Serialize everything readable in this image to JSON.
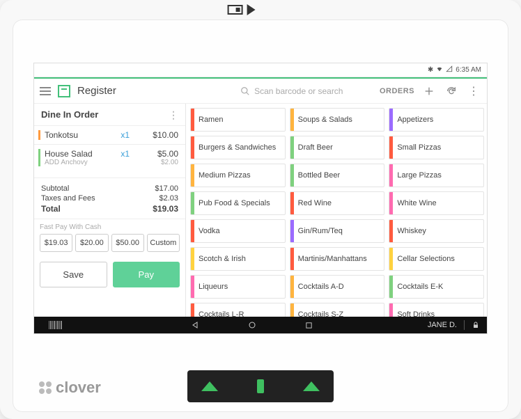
{
  "statusbar": {
    "time": "6:35 AM"
  },
  "appbar": {
    "title": "Register",
    "search_placeholder": "Scan barcode or search",
    "orders_label": "ORDERS"
  },
  "order": {
    "header": "Dine In Order",
    "items": [
      {
        "name": "Tonkotsu",
        "qty": "x1",
        "price": "$10.00",
        "mods": []
      },
      {
        "name": "House Salad",
        "qty": "x1",
        "price": "$5.00",
        "mods": [
          {
            "name": "ADD Anchovy",
            "price": "$2.00"
          }
        ]
      }
    ],
    "subtotal_label": "Subtotal",
    "subtotal": "$17.00",
    "taxes_label": "Taxes and Fees",
    "taxes": "$2.03",
    "total_label": "Total",
    "total": "$19.03",
    "fastpay_label": "Fast Pay With Cash",
    "fastpay": [
      "$19.03",
      "$20.00",
      "$50.00",
      "Custom"
    ],
    "save_label": "Save",
    "pay_label": "Pay"
  },
  "catalog": [
    {
      "label": "Ramen",
      "color": "#ff5b3f"
    },
    {
      "label": "Soups & Salads",
      "color": "#ffb43f"
    },
    {
      "label": "Appetizers",
      "color": "#9b6bff"
    },
    {
      "label": "Burgers & Sandwiches",
      "color": "#ff5b3f"
    },
    {
      "label": "Draft Beer",
      "color": "#7fd17f"
    },
    {
      "label": "Small Pizzas",
      "color": "#ff5b3f"
    },
    {
      "label": "Medium Pizzas",
      "color": "#ffb43f"
    },
    {
      "label": "Bottled Beer",
      "color": "#7fd17f"
    },
    {
      "label": "Large Pizzas",
      "color": "#ff6bb0"
    },
    {
      "label": "Pub Food & Specials",
      "color": "#7fd17f"
    },
    {
      "label": "Red Wine",
      "color": "#ff5b3f"
    },
    {
      "label": "White Wine",
      "color": "#ff6bb0"
    },
    {
      "label": "Vodka",
      "color": "#ff5b3f"
    },
    {
      "label": "Gin/Rum/Teq",
      "color": "#9b6bff"
    },
    {
      "label": "Whiskey",
      "color": "#ff5b3f"
    },
    {
      "label": "Scotch & Irish",
      "color": "#ffd23f"
    },
    {
      "label": "Martinis/Manhattans",
      "color": "#ff5b3f"
    },
    {
      "label": "Cellar Selections",
      "color": "#ffd23f"
    },
    {
      "label": "Liqueurs",
      "color": "#ff6bb0"
    },
    {
      "label": "Cocktails A-D",
      "color": "#ffb43f"
    },
    {
      "label": "Cocktails E-K",
      "color": "#7fd17f"
    },
    {
      "label": "Cocktails L-R",
      "color": "#ff5b3f"
    },
    {
      "label": "Cocktails S-Z",
      "color": "#ffb43f"
    },
    {
      "label": "Soft Drinks",
      "color": "#ff6bb0"
    }
  ],
  "navbar": {
    "user": "JANE D."
  },
  "brand": "clover"
}
